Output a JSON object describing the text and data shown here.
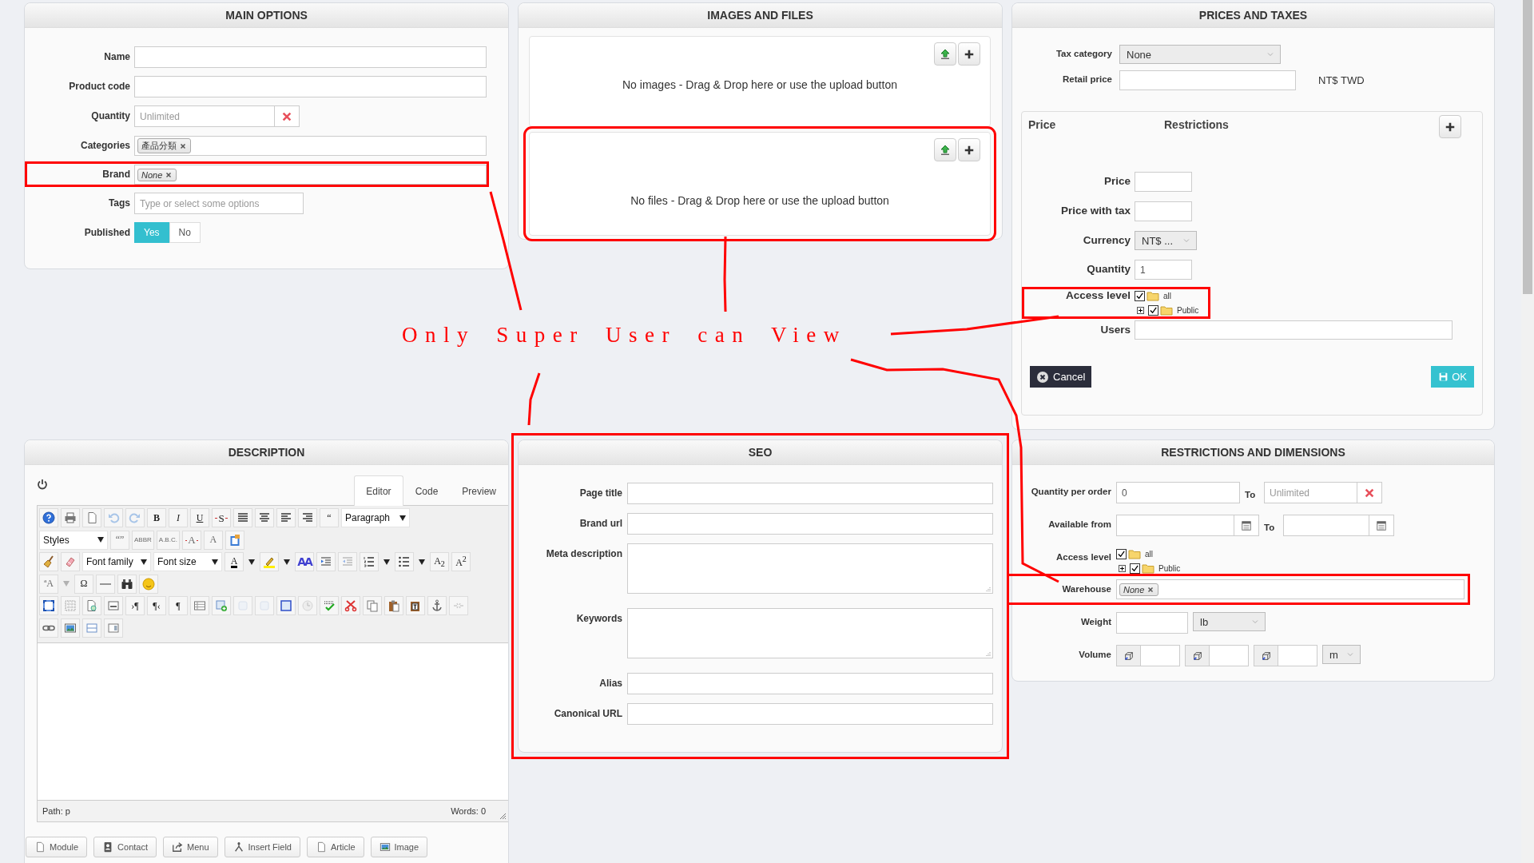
{
  "main_options": {
    "title": "MAIN OPTIONS",
    "fields": [
      {
        "kind": "text",
        "label": "Name",
        "highlighted": false
      },
      {
        "kind": "text",
        "label": "Product code",
        "highlighted": false
      },
      {
        "kind": "clearable",
        "label": "Quantity",
        "placeholder": "Unlimited",
        "highlighted": false
      },
      {
        "kind": "tags",
        "label": "Categories",
        "tags": [
          {
            "text": "產品分類",
            "empty": false
          }
        ],
        "highlighted": false
      },
      {
        "kind": "tags",
        "label": "Brand",
        "tags": [
          {
            "text": "None",
            "empty": true
          }
        ],
        "highlighted": true
      },
      {
        "kind": "short",
        "label": "Tags",
        "placeholder": "Type or select some options",
        "highlighted": false
      },
      {
        "kind": "toggle",
        "label": "Published",
        "options": [
          {
            "label": "Yes",
            "selected": true
          },
          {
            "label": "No",
            "selected": false
          }
        ],
        "highlighted": false
      }
    ]
  },
  "images_and_files": {
    "title": "IMAGES AND FILES",
    "zones": [
      {
        "message": "No images - Drag & Drop here or use the upload button",
        "highlighted": false
      },
      {
        "message": "No files - Drag & Drop here or use the upload button",
        "highlighted": true
      }
    ]
  },
  "prices_and_taxes": {
    "title": "PRICES AND TAXES",
    "tax_category": {
      "label": "Tax category",
      "value": "None"
    },
    "retail_price": {
      "label": "Retail price",
      "currency": "NT$ TWD"
    },
    "price_editor": {
      "headers": [
        "Price",
        "Restrictions"
      ],
      "fields": [
        {
          "kind": "text",
          "label": "Price",
          "highlighted": false
        },
        {
          "kind": "text",
          "label": "Price with tax",
          "highlighted": false
        },
        {
          "kind": "select",
          "label": "Currency",
          "value": "NT$ ...",
          "highlighted": false
        },
        {
          "kind": "text",
          "label": "Quantity",
          "value": "1",
          "highlighted": false
        },
        {
          "kind": "access",
          "label": "Access level",
          "tree": [
            {
              "label": "all",
              "checked": true,
              "expanded": true,
              "children": [
                {
                  "label": "Public",
                  "checked": true,
                  "expanded": false
                }
              ]
            }
          ],
          "highlighted": true
        },
        {
          "kind": "long",
          "label": "Users",
          "highlighted": false
        }
      ],
      "cancel_button": "Cancel",
      "ok_button": "OK"
    }
  },
  "description": {
    "title": "DESCRIPTION",
    "tabs": [
      {
        "label": "Editor",
        "selected": true
      },
      {
        "label": "Code",
        "selected": false
      },
      {
        "label": "Preview",
        "selected": false
      }
    ],
    "toolbar": [
      [
        {
          "kind": "help",
          "disabled": false
        },
        {
          "kind": "printer",
          "disabled": false
        },
        {
          "kind": "page",
          "disabled": false
        },
        {
          "kind": "undo",
          "disabled": true
        },
        {
          "kind": "redo",
          "disabled": true
        },
        {
          "kind": "bold",
          "label": "B",
          "disabled": false
        },
        {
          "kind": "italic",
          "label": "I",
          "disabled": false
        },
        {
          "kind": "underline",
          "label": "U",
          "disabled": false
        },
        {
          "kind": "strike",
          "label": "S",
          "disabled": false
        },
        {
          "kind": "justify",
          "disabled": false
        },
        {
          "kind": "align-center",
          "disabled": false
        },
        {
          "kind": "align-left",
          "disabled": false
        },
        {
          "kind": "align-right",
          "disabled": false
        },
        {
          "kind": "glyph",
          "label": "“",
          "disabled": false
        },
        {
          "kind": "select",
          "label": "Paragraph",
          "disabled": false
        }
      ],
      [
        {
          "kind": "select",
          "label": "Styles",
          "disabled": false
        },
        {
          "kind": "glyph",
          "label": "“”",
          "disabled": true
        },
        {
          "kind": "small",
          "label": "ABBR",
          "disabled": true
        },
        {
          "kind": "small",
          "label": "A.B.C.",
          "disabled": true
        },
        {
          "kind": "strike",
          "label": "A",
          "disabled": true
        },
        {
          "kind": "glyph",
          "label": "A",
          "disabled": true
        },
        {
          "kind": "clipboard",
          "disabled": false
        }
      ],
      [
        {
          "kind": "broom",
          "disabled": false
        },
        {
          "kind": "eraser",
          "disabled": false
        },
        {
          "kind": "select",
          "label": "Font family",
          "disabled": false
        },
        {
          "kind": "select",
          "label": "Font size",
          "disabled": false
        },
        {
          "kind": "text-color",
          "label": "A",
          "color": "#000000",
          "disabled": false
        },
        {
          "kind": "caret",
          "disabled": false
        },
        {
          "kind": "highlighter",
          "color": "#ffee00",
          "disabled": false
        },
        {
          "kind": "caret",
          "disabled": false
        },
        {
          "kind": "glyph",
          "label": "AA",
          "color": "#4040d0",
          "disabled": false
        },
        {
          "kind": "indent",
          "disabled": false
        },
        {
          "kind": "outdent",
          "disabled": true
        },
        {
          "kind": "numbered-list",
          "disabled": false
        },
        {
          "kind": "caret",
          "disabled": false
        },
        {
          "kind": "bullet-list",
          "disabled": false
        },
        {
          "kind": "caret",
          "disabled": false
        },
        {
          "kind": "glyph",
          "label": "A$_{2}$",
          "disabled": false
        },
        {
          "kind": "glyph",
          "label": "A$^{2}$",
          "disabled": false
        }
      ],
      [
        {
          "kind": "glyph",
          "label": "ªA",
          "disabled": true
        },
        {
          "kind": "caret",
          "disabled": true
        },
        {
          "kind": "glyph",
          "label": "Ω",
          "disabled": false
        },
        {
          "kind": "horizontal-line",
          "disabled": false
        },
        {
          "kind": "binoculars",
          "disabled": false
        },
        {
          "kind": "smiley",
          "disabled": false
        }
      ],
      [
        {
          "kind": "fullscreen",
          "disabled": false
        },
        {
          "kind": "grid",
          "disabled": false
        },
        {
          "kind": "page-preview",
          "disabled": false
        },
        {
          "kind": "template",
          "disabled": false
        },
        {
          "kind": "glyph",
          "label": "›¶",
          "disabled": false
        },
        {
          "kind": "glyph",
          "label": "¶‹",
          "disabled": false
        },
        {
          "kind": "glyph",
          "label": "¶",
          "disabled": false
        },
        {
          "kind": "table",
          "disabled": false
        },
        {
          "kind": "insert-row",
          "disabled": false
        },
        {
          "kind": "cell",
          "disabled": true
        },
        {
          "kind": "cell",
          "disabled": true
        },
        {
          "kind": "layer",
          "disabled": false
        },
        {
          "kind": "clock",
          "disabled": true
        },
        {
          "kind": "spellcheck",
          "disabled": false
        },
        {
          "kind": "scissors",
          "disabled": false
        },
        {
          "kind": "copy",
          "disabled": false
        },
        {
          "kind": "paste",
          "disabled": false
        },
        {
          "kind": "paste-text",
          "disabled": false
        },
        {
          "kind": "anchor",
          "disabled": false
        },
        {
          "kind": "unlink",
          "disabled": true
        }
      ],
      [
        {
          "kind": "link",
          "disabled": false
        },
        {
          "kind": "image",
          "disabled": false
        },
        {
          "kind": "horizontal-rule",
          "disabled": false
        },
        {
          "kind": "window",
          "disabled": false
        }
      ]
    ],
    "path": "Path: p",
    "words": "Words: 0",
    "insert_buttons": [
      {
        "label": "Module",
        "kind": "page"
      },
      {
        "label": "Contact",
        "kind": "contact-card"
      },
      {
        "label": "Menu",
        "kind": "share"
      },
      {
        "label": "Insert Field",
        "kind": "fork"
      },
      {
        "label": "Article",
        "kind": "page"
      },
      {
        "label": "Image",
        "kind": "image"
      }
    ]
  },
  "seo": {
    "title": "SEO",
    "highlighted": true,
    "fields": [
      {
        "kind": "text",
        "label": "Page title"
      },
      {
        "kind": "text",
        "label": "Brand url"
      },
      {
        "kind": "textarea",
        "label": "Meta description"
      },
      {
        "kind": "textarea",
        "label": "Keywords"
      },
      {
        "kind": "text",
        "label": "Alias"
      },
      {
        "kind": "text",
        "label": "Canonical URL"
      }
    ]
  },
  "restrictions_and_dimensions": {
    "title": "RESTRICTIONS AND DIMENSIONS",
    "quantity_per_order": {
      "label": "Quantity per order",
      "from": "0",
      "to_label": "To",
      "to_placeholder": "Unlimited"
    },
    "available_from": {
      "label": "Available from",
      "to_label": "To"
    },
    "access_level": {
      "label": "Access level",
      "highlighted": false,
      "tree": [
        {
          "label": "all",
          "checked": true,
          "expanded": true,
          "children": [
            {
              "label": "Public",
              "checked": true,
              "expanded": false
            }
          ]
        }
      ]
    },
    "warehouse": {
      "label": "Warehouse",
      "highlighted": true,
      "tags": [
        {
          "text": "None",
          "empty": true
        }
      ]
    },
    "weight": {
      "label": "Weight",
      "unit": "lb"
    },
    "volume": {
      "label": "Volume",
      "unit": "m"
    }
  },
  "annotation": {
    "text": "Only Super User can View"
  }
}
